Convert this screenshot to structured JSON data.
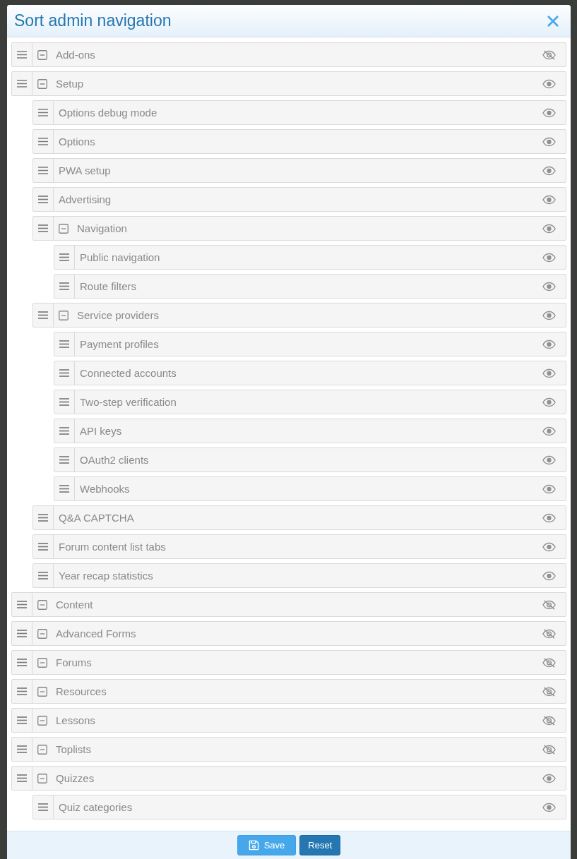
{
  "dialog": {
    "title": "Sort admin navigation"
  },
  "items": [
    {
      "label": "Add-ons",
      "kind": "section",
      "expanded": true,
      "visible": false
    },
    {
      "label": "Setup",
      "kind": "section",
      "expanded": true,
      "visible": true,
      "children": [
        {
          "label": "Options debug mode",
          "kind": "link",
          "visible": true
        },
        {
          "label": "Options",
          "kind": "link",
          "visible": true
        },
        {
          "label": "PWA setup",
          "kind": "link",
          "visible": true
        },
        {
          "label": "Advertising",
          "kind": "link",
          "visible": true
        },
        {
          "label": "Navigation",
          "kind": "section",
          "expanded": true,
          "visible": true,
          "children": [
            {
              "label": "Public navigation",
              "kind": "link",
              "visible": true
            },
            {
              "label": "Route filters",
              "kind": "link",
              "visible": true
            }
          ]
        },
        {
          "label": "Service providers",
          "kind": "section",
          "expanded": true,
          "visible": true,
          "children": [
            {
              "label": "Payment profiles",
              "kind": "link",
              "visible": true
            },
            {
              "label": "Connected accounts",
              "kind": "link",
              "visible": true
            },
            {
              "label": "Two-step verification",
              "kind": "link",
              "visible": true
            },
            {
              "label": "API keys",
              "kind": "link",
              "visible": true
            },
            {
              "label": "OAuth2 clients",
              "kind": "link",
              "visible": true
            },
            {
              "label": "Webhooks",
              "kind": "link",
              "visible": true
            }
          ]
        },
        {
          "label": "Q&A CAPTCHA",
          "kind": "link",
          "visible": true
        },
        {
          "label": "Forum content list tabs",
          "kind": "link",
          "visible": true
        },
        {
          "label": "Year recap statistics",
          "kind": "link",
          "visible": true
        }
      ]
    },
    {
      "label": "Content",
      "kind": "section",
      "expanded": true,
      "visible": false
    },
    {
      "label": "Advanced Forms",
      "kind": "section",
      "expanded": true,
      "visible": false
    },
    {
      "label": "Forums",
      "kind": "section",
      "expanded": true,
      "visible": false
    },
    {
      "label": "Resources",
      "kind": "section",
      "expanded": true,
      "visible": false
    },
    {
      "label": "Lessons",
      "kind": "section",
      "expanded": true,
      "visible": false
    },
    {
      "label": "Toplists",
      "kind": "section",
      "expanded": true,
      "visible": false
    },
    {
      "label": "Quizzes",
      "kind": "section",
      "expanded": true,
      "visible": true,
      "children": [
        {
          "label": "Quiz categories",
          "kind": "link",
          "visible": true
        }
      ]
    }
  ],
  "footer": {
    "buttons": [
      {
        "label": "Save",
        "kind": "primary"
      },
      {
        "label": "Reset",
        "kind": "secondary"
      }
    ]
  }
}
